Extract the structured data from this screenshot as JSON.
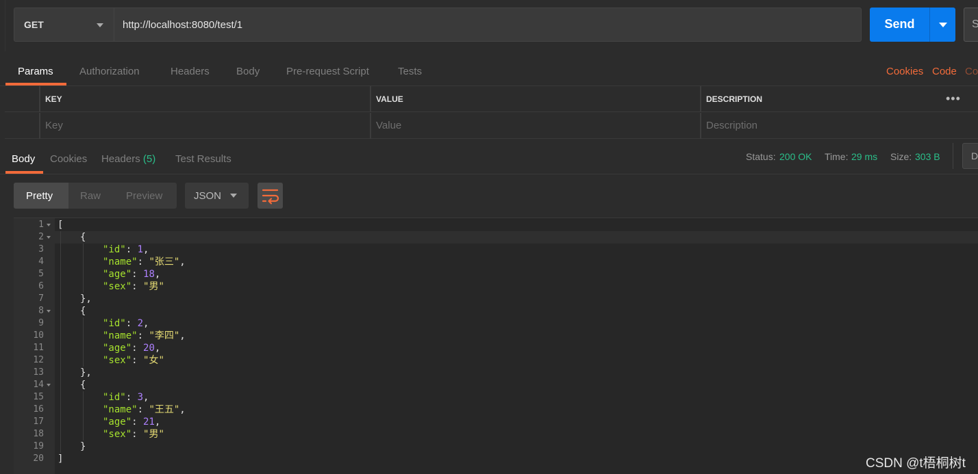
{
  "request": {
    "method": "GET",
    "url": "http://localhost:8080/test/1",
    "send_label": "Send",
    "save_label": "S"
  },
  "request_tabs": [
    "Params",
    "Authorization",
    "Headers",
    "Body",
    "Pre-request Script",
    "Tests"
  ],
  "request_right_links": [
    "Cookies",
    "Code",
    "Co"
  ],
  "params": {
    "headers": [
      "KEY",
      "VALUE",
      "DESCRIPTION"
    ],
    "placeholders": [
      "Key",
      "Value",
      "Description"
    ]
  },
  "response_tabs": {
    "body": "Body",
    "cookies": "Cookies",
    "headers": "Headers",
    "headers_count": "(5)",
    "test_results": "Test Results"
  },
  "status": {
    "status_label": "Status:",
    "status_value": "200 OK",
    "time_label": "Time:",
    "time_value": "29 ms",
    "size_label": "Size:",
    "size_value": "303 B",
    "download_label": "D"
  },
  "view_modes": [
    "Pretty",
    "Raw",
    "Preview"
  ],
  "format": "JSON",
  "response_body": [
    {
      "id": 1,
      "name": "张三",
      "age": 18,
      "sex": "男"
    },
    {
      "id": 2,
      "name": "李四",
      "age": 20,
      "sex": "女"
    },
    {
      "id": 3,
      "name": "王五",
      "age": 21,
      "sex": "男"
    }
  ],
  "watermark": "CSDN @t梧桐树t",
  "colors": {
    "accent": "#f26b3a",
    "send": "#097bed",
    "status_ok": "#2bbf8a",
    "json_key": "#a6e22e",
    "json_number": "#ae81ff",
    "json_string": "#e6db74"
  }
}
